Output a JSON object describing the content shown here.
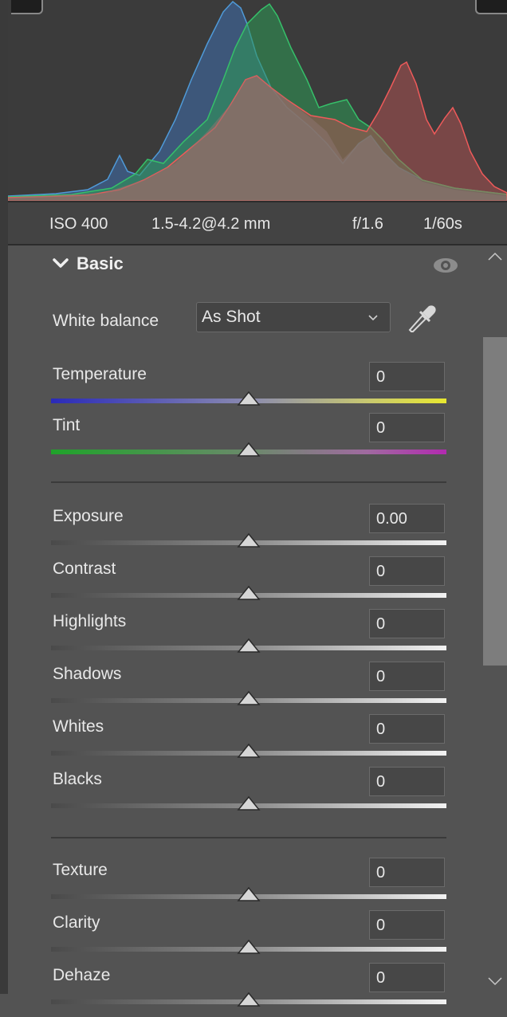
{
  "camera_info": {
    "iso": "ISO 400",
    "lens": "1.5-4.2@4.2 mm",
    "aperture": "f/1.6",
    "shutter": "1/60s"
  },
  "section": {
    "title": "Basic",
    "icon": "chevron-down-icon",
    "visibility_icon": "eye-icon"
  },
  "white_balance": {
    "label": "White balance",
    "value": "As Shot",
    "picker_icon": "eyedropper-icon"
  },
  "sliders": [
    {
      "label": "Temperature",
      "value": "0",
      "level": 0.5,
      "track": "temperature"
    },
    {
      "label": "Tint",
      "value": "0",
      "level": 0.5,
      "track": "tint"
    },
    {
      "label": "Exposure",
      "value": "0.00",
      "level": 0.5,
      "track": "neutral"
    },
    {
      "label": "Contrast",
      "value": "0",
      "level": 0.5,
      "track": "neutral"
    },
    {
      "label": "Highlights",
      "value": "0",
      "level": 0.5,
      "track": "neutral"
    },
    {
      "label": "Shadows",
      "value": "0",
      "level": 0.5,
      "track": "neutral"
    },
    {
      "label": "Whites",
      "value": "0",
      "level": 0.5,
      "track": "neutral"
    },
    {
      "label": "Blacks",
      "value": "0",
      "level": 0.5,
      "track": "neutral"
    },
    {
      "label": "Texture",
      "value": "0",
      "level": 0.5,
      "track": "neutral"
    },
    {
      "label": "Clarity",
      "value": "0",
      "level": 0.5,
      "track": "neutral"
    },
    {
      "label": "Dehaze",
      "value": "0",
      "level": 0.5,
      "track": "neutral"
    }
  ],
  "colors": {
    "panel_bg": "#535353",
    "histogram_red": "#e04a4a",
    "histogram_green": "#2fa35a",
    "histogram_blue": "#3f74b8"
  }
}
